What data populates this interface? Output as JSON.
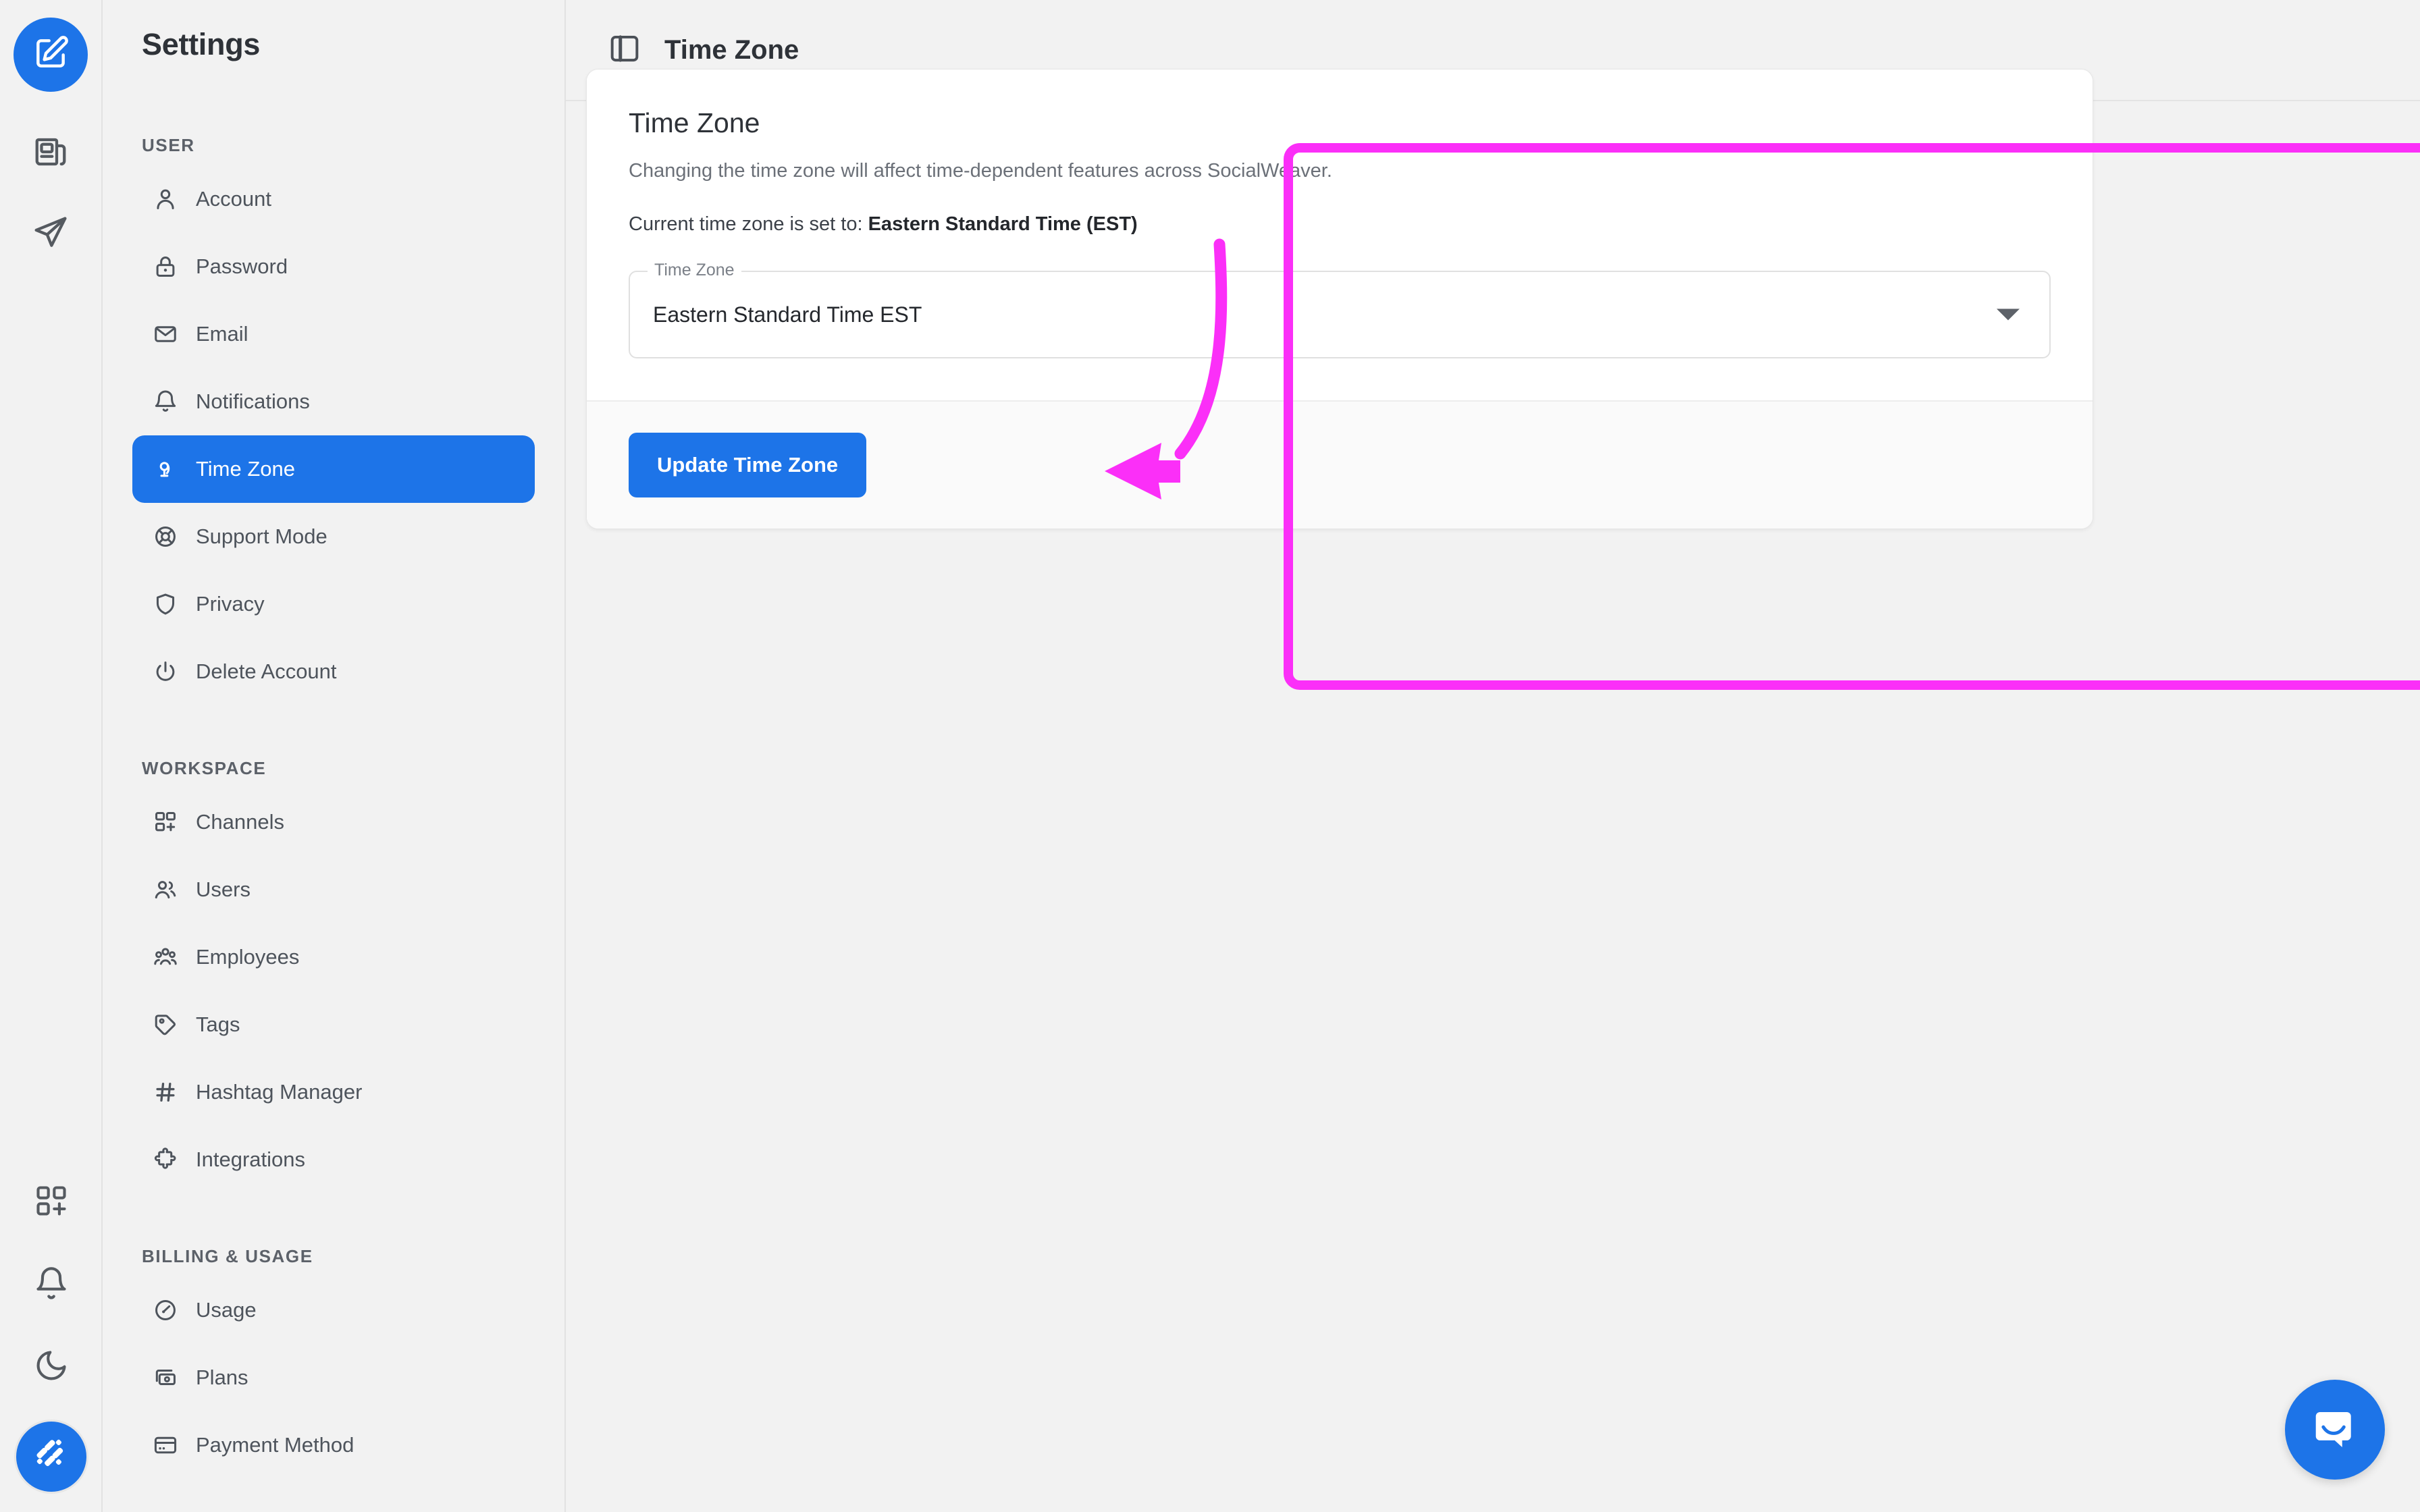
{
  "app": {
    "logo_icon": "compose-edit-icon",
    "accent_color": "#1d74e8",
    "annotation_color": "#fb2ff8"
  },
  "rail": {
    "items": [
      {
        "icon": "newspaper-icon",
        "name": "feed"
      },
      {
        "icon": "paper-plane-icon",
        "name": "publish"
      }
    ],
    "bottom_items": [
      {
        "icon": "apps-add-icon",
        "name": "apps"
      },
      {
        "icon": "bell-icon",
        "name": "notifications"
      },
      {
        "icon": "moon-icon",
        "name": "dark-mode"
      }
    ],
    "avatar_icon": "workspace-avatar-icon"
  },
  "sidebar": {
    "title": "Settings",
    "sections": [
      {
        "label": "USER",
        "items": [
          {
            "label": "Account",
            "icon": "user-icon",
            "active": false
          },
          {
            "label": "Password",
            "icon": "lock-icon",
            "active": false
          },
          {
            "label": "Email",
            "icon": "envelope-icon",
            "active": false
          },
          {
            "label": "Notifications",
            "icon": "bell-icon",
            "active": false
          },
          {
            "label": "Time Zone",
            "icon": "globe-stand-icon",
            "active": true
          },
          {
            "label": "Support Mode",
            "icon": "lifebuoy-icon",
            "active": false
          },
          {
            "label": "Privacy",
            "icon": "shield-icon",
            "active": false
          },
          {
            "label": "Delete Account",
            "icon": "power-icon",
            "active": false
          }
        ]
      },
      {
        "label": "WORKSPACE",
        "items": [
          {
            "label": "Channels",
            "icon": "grid-add-icon",
            "active": false
          },
          {
            "label": "Users",
            "icon": "users-icon",
            "active": false
          },
          {
            "label": "Employees",
            "icon": "people-icon",
            "active": false
          },
          {
            "label": "Tags",
            "icon": "tag-icon",
            "active": false
          },
          {
            "label": "Hashtag Manager",
            "icon": "hash-icon",
            "active": false
          },
          {
            "label": "Integrations",
            "icon": "puzzle-icon",
            "active": false
          }
        ]
      },
      {
        "label": "BILLING & USAGE",
        "items": [
          {
            "label": "Usage",
            "icon": "gauge-icon",
            "active": false
          },
          {
            "label": "Plans",
            "icon": "banknote-icon",
            "active": false
          },
          {
            "label": "Payment Method",
            "icon": "credit-card-icon",
            "active": false
          }
        ]
      }
    ]
  },
  "topbar": {
    "panel_toggle_icon": "sidebar-panel-icon",
    "title": "Time Zone"
  },
  "card": {
    "title": "Time Zone",
    "description": "Changing the time zone will affect time-dependent features across SocialWeaver.",
    "current_prefix": "Current time zone is set to: ",
    "current_value": "Eastern Standard Time (EST)",
    "field": {
      "legend": "Time Zone",
      "value": "Eastern Standard Time EST",
      "caret_icon": "chevron-down-icon"
    },
    "submit_label": "Update Time Zone"
  },
  "support_widget": {
    "icon": "intercom-chat-icon"
  }
}
